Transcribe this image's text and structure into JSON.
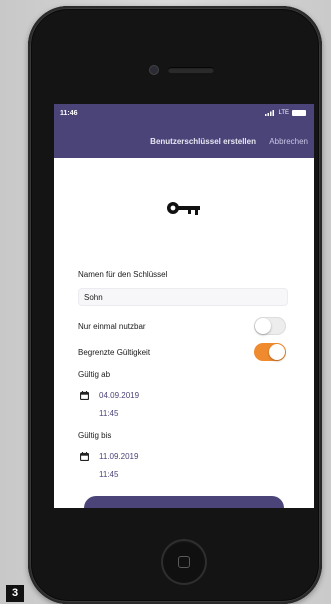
{
  "status_bar": {
    "time": "11:46",
    "network": "LTE"
  },
  "header": {
    "title": "Benutzerschlüssel erstellen",
    "cancel_label": "Abbrechen"
  },
  "form": {
    "name_label": "Namen für den Schlüssel",
    "name_value": "Sohn",
    "single_use_label": "Nur einmal nutzbar",
    "single_use_enabled": false,
    "limited_validity_label": "Begrenzte Gültigkeit",
    "limited_validity_enabled": true,
    "valid_from_label": "Gültig ab",
    "valid_from_date": "04.09.2019",
    "valid_from_time": "11:45",
    "valid_until_label": "Gültig bis",
    "valid_until_date": "11.09.2019",
    "valid_until_time": "11:45"
  },
  "figure_number": "3",
  "colors": {
    "header": "#4a4478",
    "toggle_on": "#f08a2e",
    "accent_text": "#4a4478"
  },
  "icons": [
    "key-icon",
    "calendar-icon",
    "signal-icon",
    "battery-icon",
    "home-button-icon"
  ]
}
